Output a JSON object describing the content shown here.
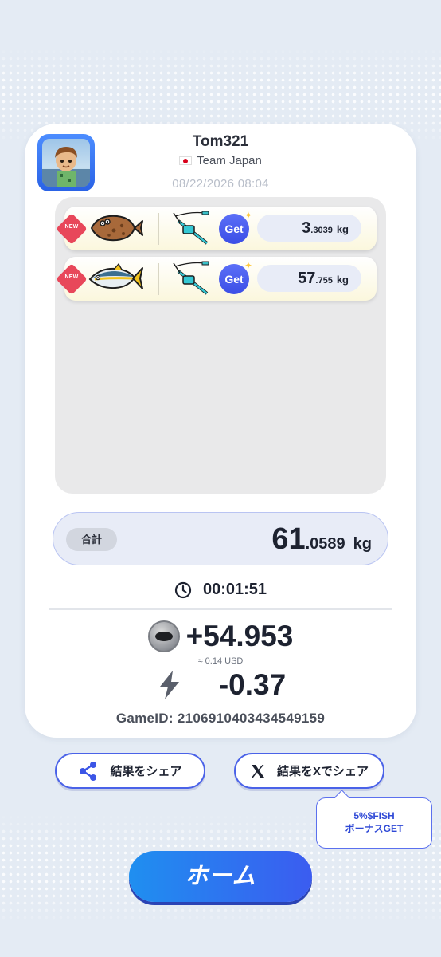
{
  "player": {
    "name": "Tom321",
    "team": "Team Japan",
    "datetime": "08/22/2026 08:04"
  },
  "catches": [
    {
      "badge": "NEW",
      "fish": "flounder-icon",
      "get_label": "Get",
      "weight_int": "3",
      "weight_dec": ".3039",
      "unit": "kg"
    },
    {
      "badge": "NEW",
      "fish": "yellowtail-icon",
      "get_label": "Get",
      "weight_int": "57",
      "weight_dec": ".755",
      "unit": "kg"
    }
  ],
  "total": {
    "label": "合計",
    "value_int": "61",
    "value_dec": ".0589",
    "unit": "kg"
  },
  "timer": "00:01:51",
  "reward": {
    "value": "+54.953",
    "usd": "≈ 0.14 USD"
  },
  "energy": {
    "value": "-0.37"
  },
  "game_id": "GameID: 2106910403434549159",
  "buttons": {
    "share": "結果をシェア",
    "share_x": "結果をXでシェア",
    "home": "ホーム"
  },
  "tooltip": {
    "line1": "5%$FISH",
    "line2": "ボーナスGET"
  },
  "colors": {
    "accent": "#3b5cf0",
    "background": "#e4ebf4",
    "new_badge": "#e8475a"
  }
}
